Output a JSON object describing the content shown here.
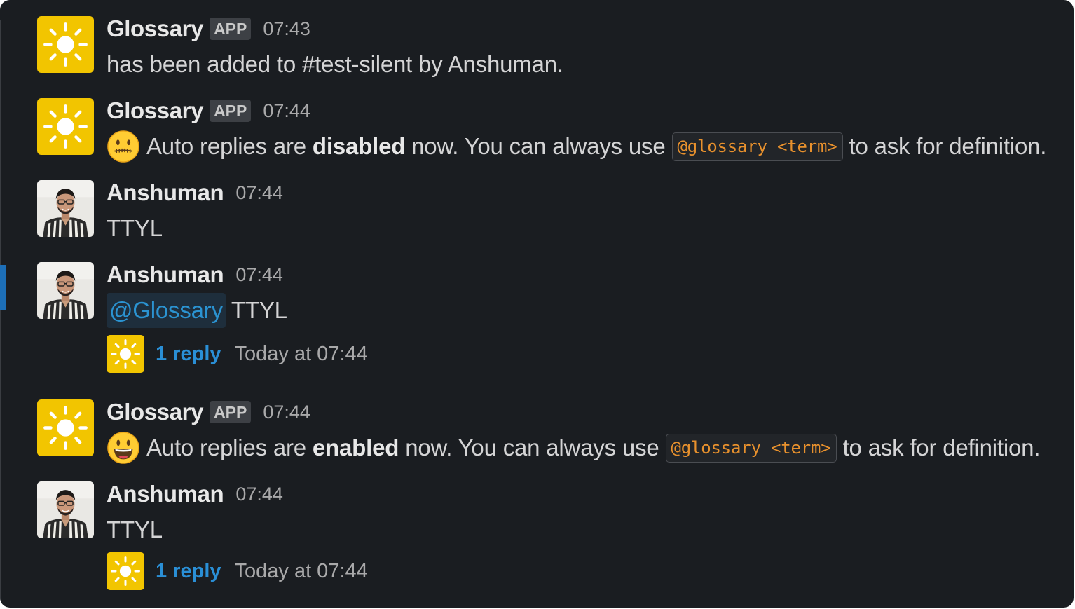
{
  "colors": {
    "background": "#1a1d21",
    "app_avatar": "#f2c500",
    "code_text": "#e8912d",
    "link": "#2a8fd6",
    "mention_text": "#2b93d1",
    "active_indicator": "#1d6fb8"
  },
  "messages": [
    {
      "sender": "Glossary",
      "badge": "APP",
      "time": "07:43",
      "avatar_icon": "sun-icon",
      "text": "has been added to #test-silent by Anshuman."
    },
    {
      "sender": "Glossary",
      "badge": "APP",
      "time": "07:44",
      "avatar_icon": "sun-icon",
      "emoji": "zipper-mouth-face-emoji",
      "text_before": "Auto replies are",
      "text_bold": "disabled",
      "text_mid": "now. You can always use",
      "code": "@glossary <term>",
      "text_after": "to ask for definition."
    },
    {
      "sender": "Anshuman",
      "time": "07:44",
      "avatar_icon": "user-photo",
      "text": "TTYL"
    },
    {
      "sender": "Anshuman",
      "time": "07:44",
      "avatar_icon": "user-photo",
      "mention": "@Glossary",
      "text": "TTYL",
      "thread": {
        "reply_count": "1 reply",
        "last_reply": "Today at 07:44",
        "avatar_icon": "sun-icon"
      }
    },
    {
      "sender": "Glossary",
      "badge": "APP",
      "time": "07:44",
      "avatar_icon": "sun-icon",
      "emoji": "smiley-face-emoji",
      "text_before": "Auto replies are",
      "text_bold": "enabled",
      "text_mid": "now. You can always use",
      "code": "@glossary <term>",
      "text_after": "to ask for definition."
    },
    {
      "sender": "Anshuman",
      "time": "07:44",
      "avatar_icon": "user-photo",
      "text": "TTYL",
      "thread": {
        "reply_count": "1 reply",
        "last_reply": "Today at 07:44",
        "avatar_icon": "sun-icon"
      }
    }
  ]
}
